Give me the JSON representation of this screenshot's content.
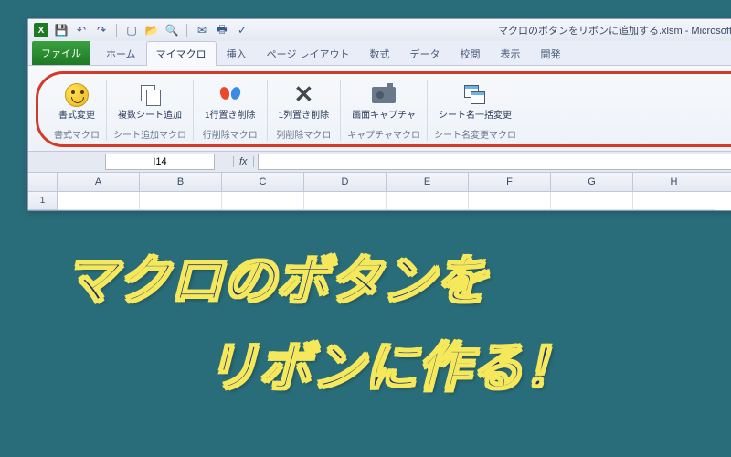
{
  "window": {
    "title": "マクロのボタンをリボンに追加する.xlsm - Microsoft Excel"
  },
  "qat": {
    "items": [
      "save-icon",
      "undo-icon",
      "redo-icon",
      "new-icon",
      "open-icon",
      "print-preview-icon",
      "email-icon",
      "quick-print-icon",
      "spell-check-icon"
    ]
  },
  "tabs": {
    "file": "ファイル",
    "items": [
      {
        "id": "home",
        "label": "ホーム"
      },
      {
        "id": "mymacro",
        "label": "マイマクロ",
        "active": true
      },
      {
        "id": "insert",
        "label": "挿入"
      },
      {
        "id": "pagelayout",
        "label": "ページ レイアウト"
      },
      {
        "id": "formulas",
        "label": "数式"
      },
      {
        "id": "data",
        "label": "データ"
      },
      {
        "id": "review",
        "label": "校閲"
      },
      {
        "id": "view",
        "label": "表示"
      },
      {
        "id": "developer",
        "label": "開発"
      }
    ]
  },
  "ribbon": {
    "groups": [
      {
        "button": "書式変更",
        "group_label": "書式マクロ",
        "icon": "smile"
      },
      {
        "button": "複数シート追加",
        "group_label": "シート追加マクロ",
        "icon": "copy"
      },
      {
        "button": "1行置き削除",
        "group_label": "行削除マクロ",
        "icon": "butterfly"
      },
      {
        "button": "1列置き削除",
        "group_label": "列削除マクロ",
        "icon": "cross"
      },
      {
        "button": "画面キャプチャ",
        "group_label": "キャプチャマクロ",
        "icon": "camera"
      },
      {
        "button": "シート名一括変更",
        "group_label": "シート名変更マクロ",
        "icon": "cascade"
      }
    ]
  },
  "formula_bar": {
    "name_box": "I14",
    "fx_label": "fx"
  },
  "grid": {
    "columns": [
      "A",
      "B",
      "C",
      "D",
      "E",
      "F",
      "G",
      "H"
    ],
    "rows": [
      "1"
    ]
  },
  "overlay": {
    "line1": "マクロのボタンを",
    "line2": "リボンに作る！"
  }
}
